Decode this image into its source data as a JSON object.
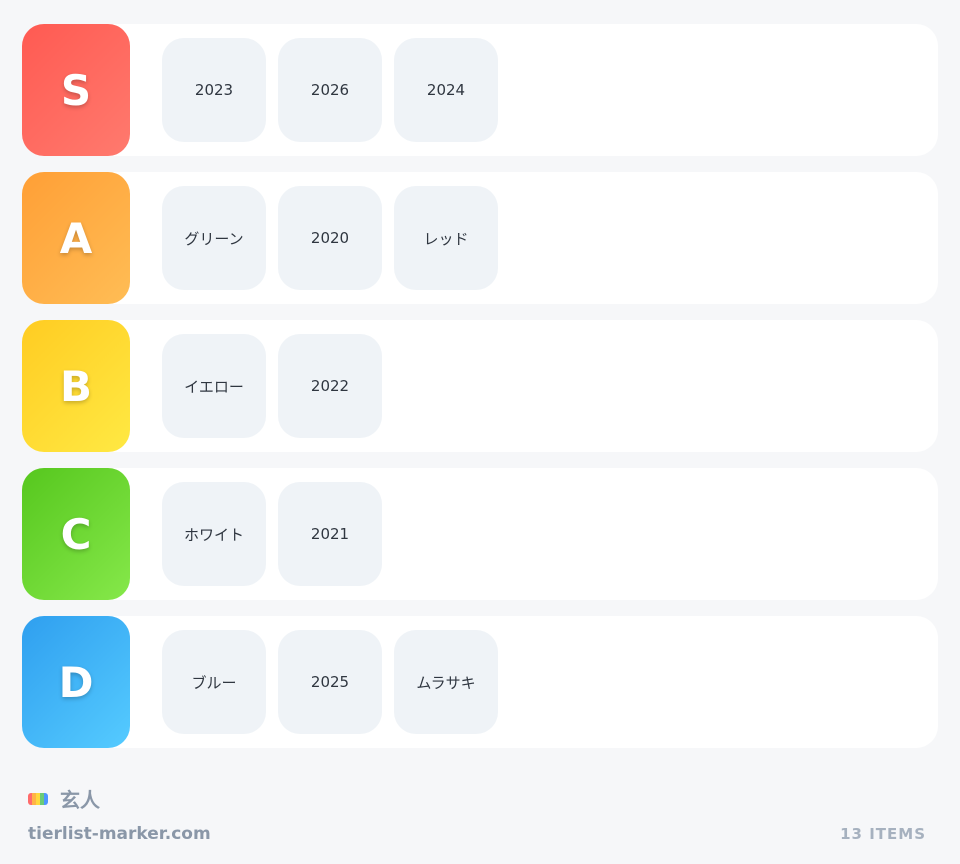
{
  "tiers": [
    {
      "label": "S",
      "color_from": "#ff5a52",
      "color_to": "#ff7a6e",
      "items": [
        "2023",
        "2026",
        "2024"
      ]
    },
    {
      "label": "A",
      "color_from": "#ff9f36",
      "color_to": "#ffbd55",
      "items": [
        "グリーン",
        "2020",
        "レッド"
      ]
    },
    {
      "label": "B",
      "color_from": "#ffcc22",
      "color_to": "#ffe943",
      "items": [
        "イエロー",
        "2022"
      ]
    },
    {
      "label": "C",
      "color_from": "#56c71e",
      "color_to": "#86e84a",
      "items": [
        "ホワイト",
        "2021"
      ]
    },
    {
      "label": "D",
      "color_from": "#2f9fef",
      "color_to": "#55cbff",
      "items": [
        "ブルー",
        "2025",
        "ムラサキ"
      ]
    }
  ],
  "footer": {
    "owner": "玄人",
    "site": "tierlist-marker.com",
    "count": "13 ITEMS",
    "palette": [
      "#ff6b6b",
      "#ffb347",
      "#ffd93d",
      "#6bcb77",
      "#4d96ff"
    ]
  }
}
